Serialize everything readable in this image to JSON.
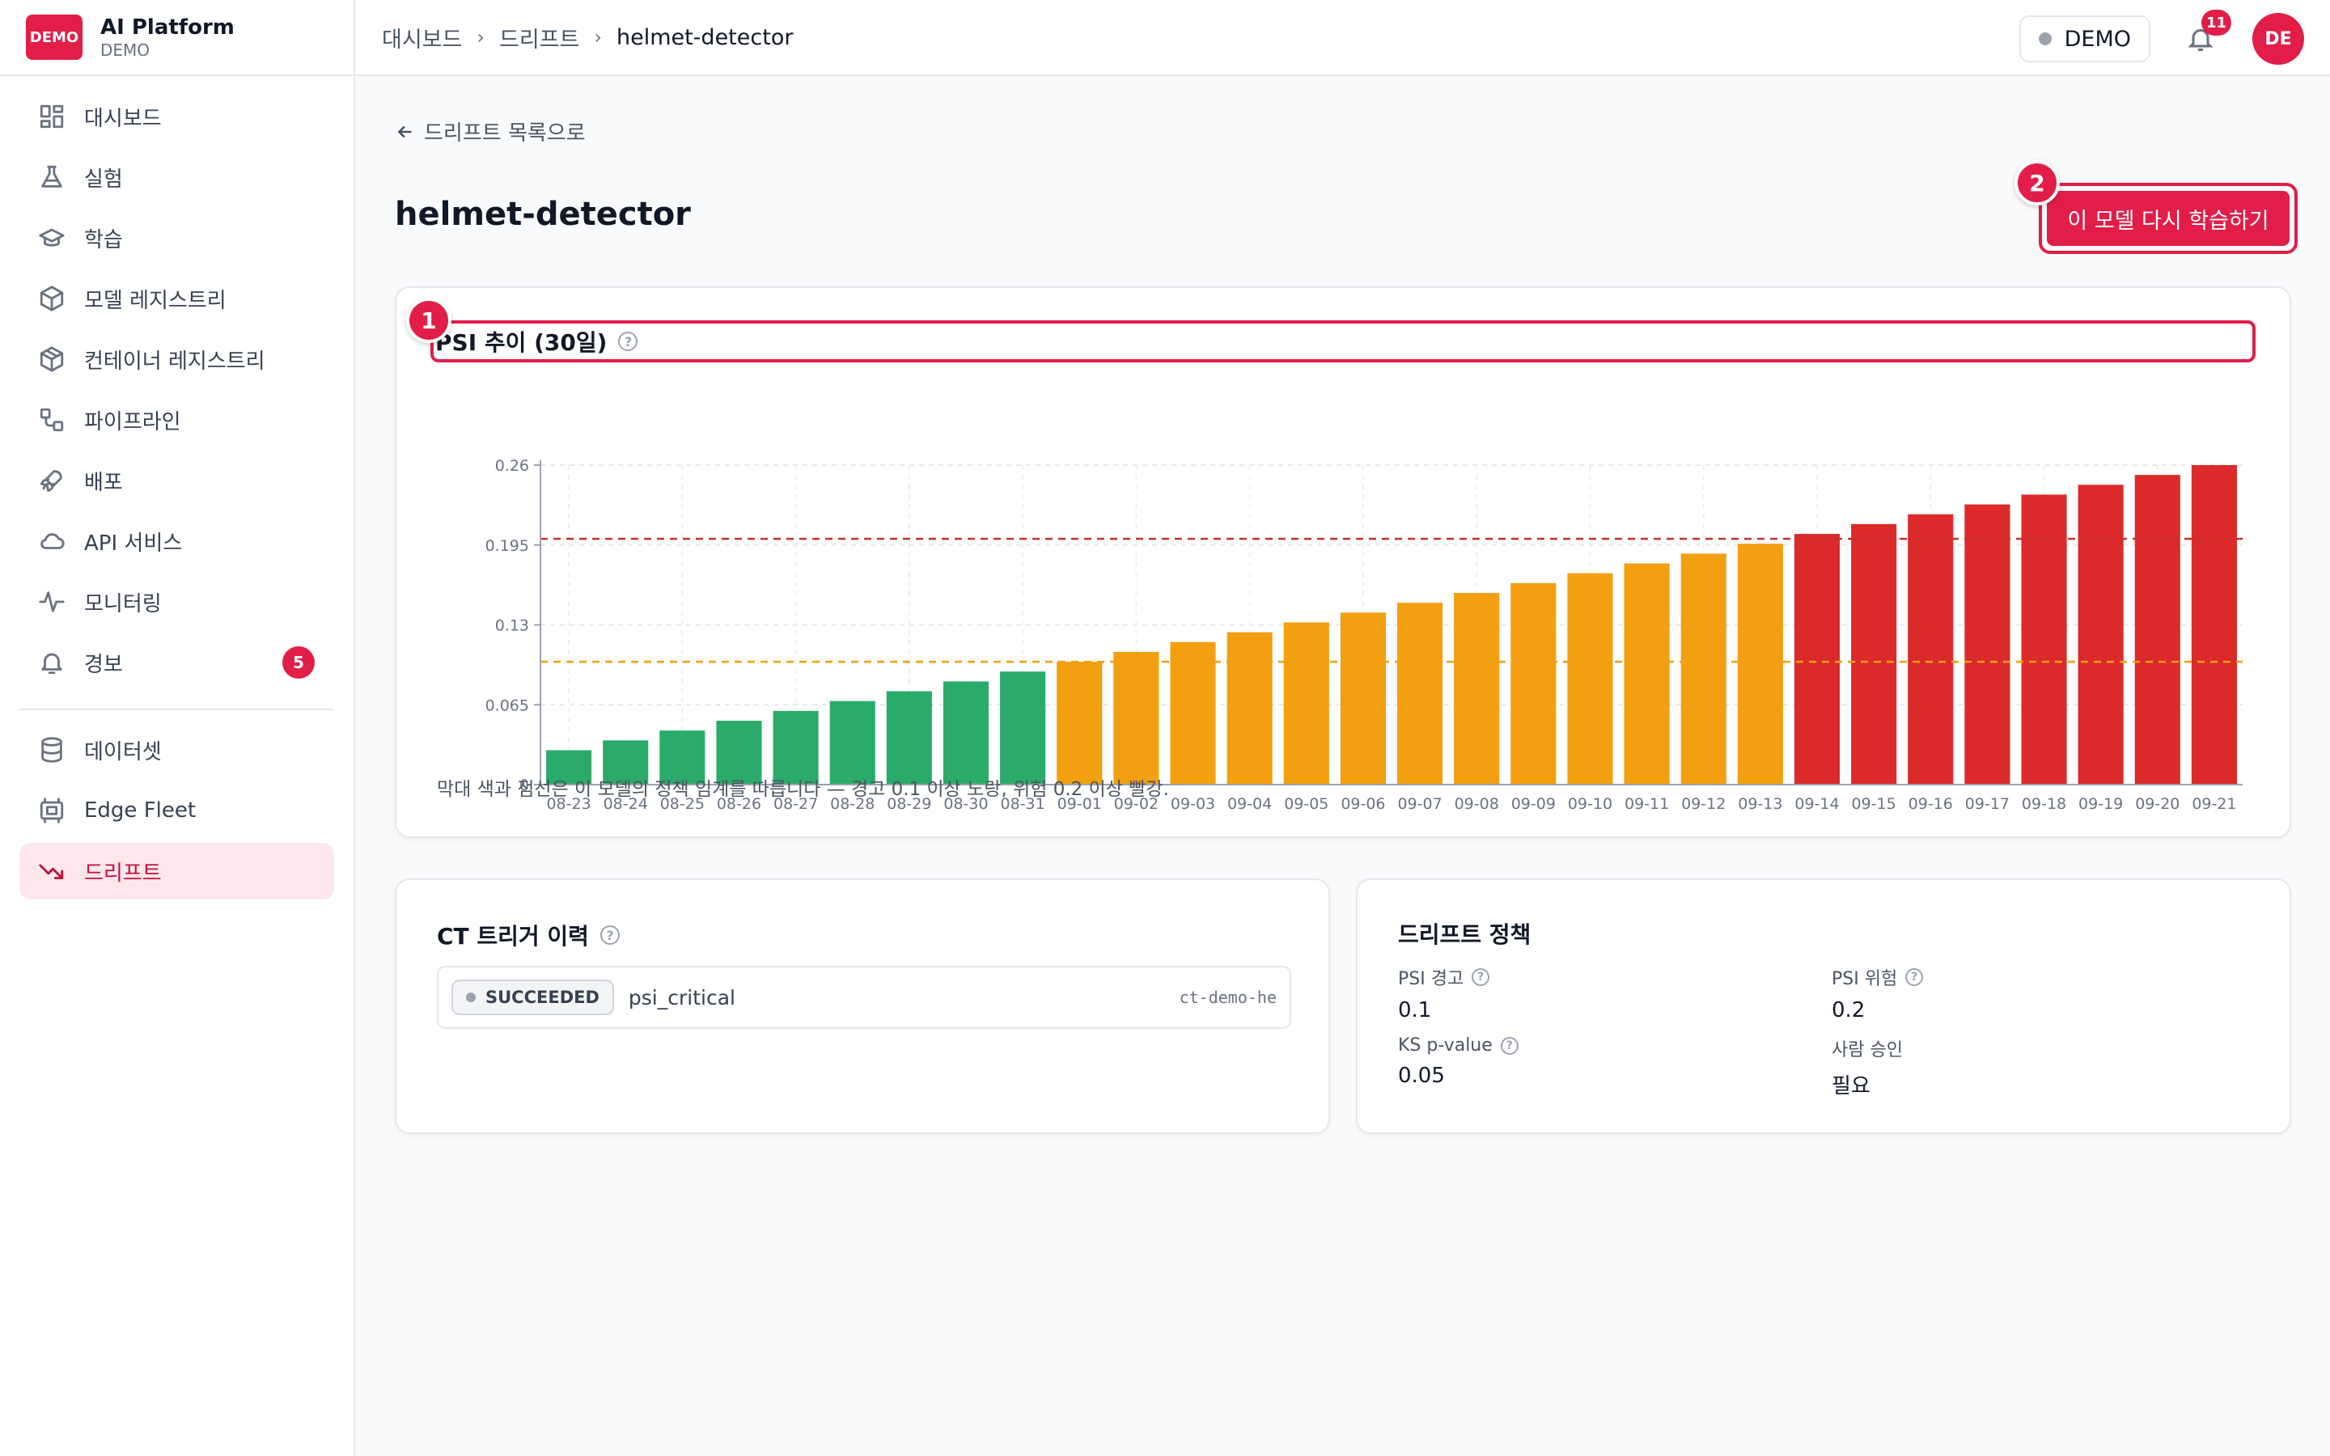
{
  "brand": {
    "logo": "DEMO",
    "title": "AI Platform",
    "subtitle": "DEMO"
  },
  "sidebar": {
    "items": [
      {
        "label": "대시보드",
        "icon": "dashboard-icon"
      },
      {
        "label": "실험",
        "icon": "flask-icon"
      },
      {
        "label": "학습",
        "icon": "graduation-cap-icon"
      },
      {
        "label": "모델 레지스트리",
        "icon": "box-icon"
      },
      {
        "label": "컨테이너 레지스트리",
        "icon": "package-icon"
      },
      {
        "label": "파이프라인",
        "icon": "workflow-icon"
      },
      {
        "label": "배포",
        "icon": "rocket-icon"
      },
      {
        "label": "API 서비스",
        "icon": "cloud-icon"
      },
      {
        "label": "모니터링",
        "icon": "activity-icon"
      },
      {
        "label": "경보",
        "icon": "bell-icon",
        "badge": "5"
      },
      {
        "label": "데이터셋",
        "icon": "database-icon"
      },
      {
        "label": "Edge Fleet",
        "icon": "chip-icon"
      },
      {
        "label": "드리프트",
        "icon": "trending-down-icon",
        "active": true
      }
    ]
  },
  "topbar": {
    "breadcrumbs": [
      "대시보드",
      "드리프트",
      "helmet-detector"
    ],
    "env_label": "DEMO",
    "notification_count": "11",
    "avatar_initials": "DE"
  },
  "main": {
    "back_link": "드리프트 목록으로",
    "title": "helmet-detector",
    "retrain_button": "이 모델 다시 학습하기",
    "markers": [
      "1",
      "2"
    ],
    "psi_card": {
      "title": "PSI 추이 (30일)",
      "note": "막대 색과 점선은 이 모델의 정책 임계를 따릅니다 — 경고 0.1 이상 노랑, 위험 0.2 이상 빨강."
    },
    "ct_card": {
      "title": "CT 트리거 이력",
      "rows": [
        {
          "status": "SUCCEEDED",
          "reason": "psi_critical",
          "id": "ct-demo-he"
        }
      ]
    },
    "policy_card": {
      "title": "드리프트 정책",
      "items": [
        {
          "label": "PSI 경고",
          "value": "0.1",
          "help": true
        },
        {
          "label": "PSI 위험",
          "value": "0.2",
          "help": true
        },
        {
          "label": "KS p-value",
          "value": "0.05",
          "help": true
        },
        {
          "label": "사람 승인",
          "value": "필요",
          "help": false
        }
      ]
    }
  },
  "colors": {
    "accent": "#e11d48",
    "bar_ok": "#2bab6a",
    "bar_warn": "#f29f10",
    "bar_critical": "#dc2929"
  },
  "chart_data": {
    "type": "bar",
    "categories": [
      "08-23",
      "08-24",
      "08-25",
      "08-26",
      "08-27",
      "08-28",
      "08-29",
      "08-30",
      "08-31",
      "09-01",
      "09-02",
      "09-03",
      "09-04",
      "09-05",
      "09-06",
      "09-07",
      "09-08",
      "09-09",
      "09-10",
      "09-11",
      "09-12",
      "09-13",
      "09-14",
      "09-15",
      "09-16",
      "09-17",
      "09-18",
      "09-19",
      "09-20",
      "09-21"
    ],
    "values": [
      0.028,
      0.036,
      0.044,
      0.052,
      0.06,
      0.068,
      0.076,
      0.084,
      0.092,
      0.1,
      0.108,
      0.116,
      0.124,
      0.132,
      0.14,
      0.148,
      0.156,
      0.164,
      0.172,
      0.18,
      0.188,
      0.196,
      0.204,
      0.212,
      0.22,
      0.228,
      0.236,
      0.244,
      0.252,
      0.26
    ],
    "yticks": [
      "0",
      "0.065",
      "0.13",
      "0.195",
      "0.26"
    ],
    "ylim": [
      0,
      0.26
    ],
    "thresholds": {
      "warning": 0.1,
      "critical": 0.2
    },
    "grid": true
  }
}
